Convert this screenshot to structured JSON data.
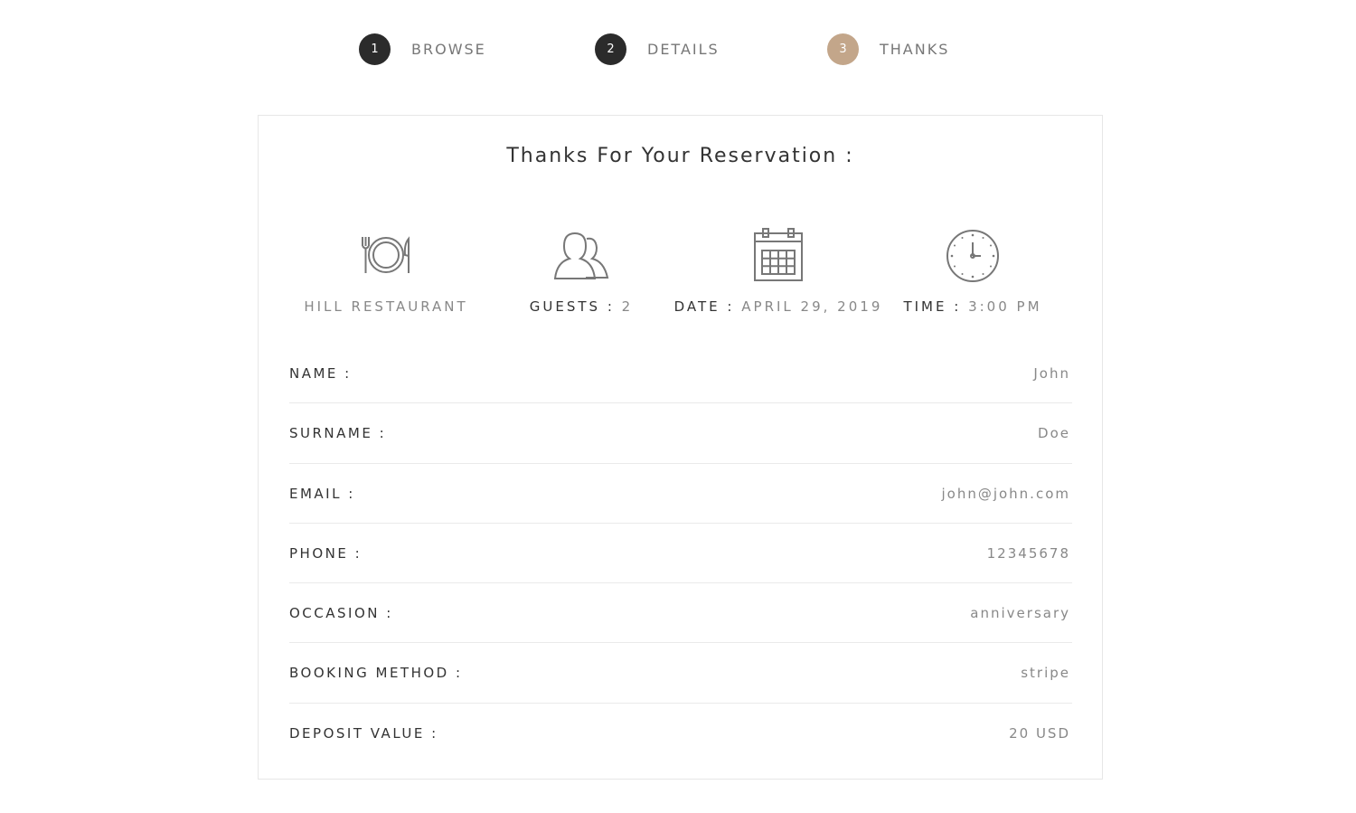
{
  "steps": [
    {
      "number": "1",
      "label": "BROWSE",
      "color": "#2b2b2b"
    },
    {
      "number": "2",
      "label": "DETAILS",
      "color": "#2b2b2b"
    },
    {
      "number": "3",
      "label": "THANKS",
      "color": "#c3a68a"
    }
  ],
  "card": {
    "title": "Thanks For Your Reservation :"
  },
  "summary": {
    "restaurant": {
      "value": "HILL RESTAURANT",
      "icon": "plate-cutlery-icon"
    },
    "guests": {
      "label": "GUESTS :",
      "value": "2",
      "icon": "users-icon"
    },
    "date": {
      "label": "DATE :",
      "value": "APRIL 29, 2019",
      "icon": "calendar-icon"
    },
    "time": {
      "label": "TIME :",
      "value": "3:00 PM",
      "icon": "clock-icon"
    }
  },
  "details": [
    {
      "label": "NAME :",
      "value": "John"
    },
    {
      "label": "SURNAME :",
      "value": "Doe"
    },
    {
      "label": "EMAIL :",
      "value": "john@john.com"
    },
    {
      "label": "PHONE :",
      "value": "12345678"
    },
    {
      "label": "OCCASION :",
      "value": "anniversary"
    },
    {
      "label": "BOOKING METHOD :",
      "value": "stripe"
    },
    {
      "label": "DEPOSIT VALUE :",
      "value": "20 USD"
    }
  ],
  "colors": {
    "step_active": "#2b2b2b",
    "step_current": "#c3a68a",
    "icon_gray": "#777777"
  }
}
